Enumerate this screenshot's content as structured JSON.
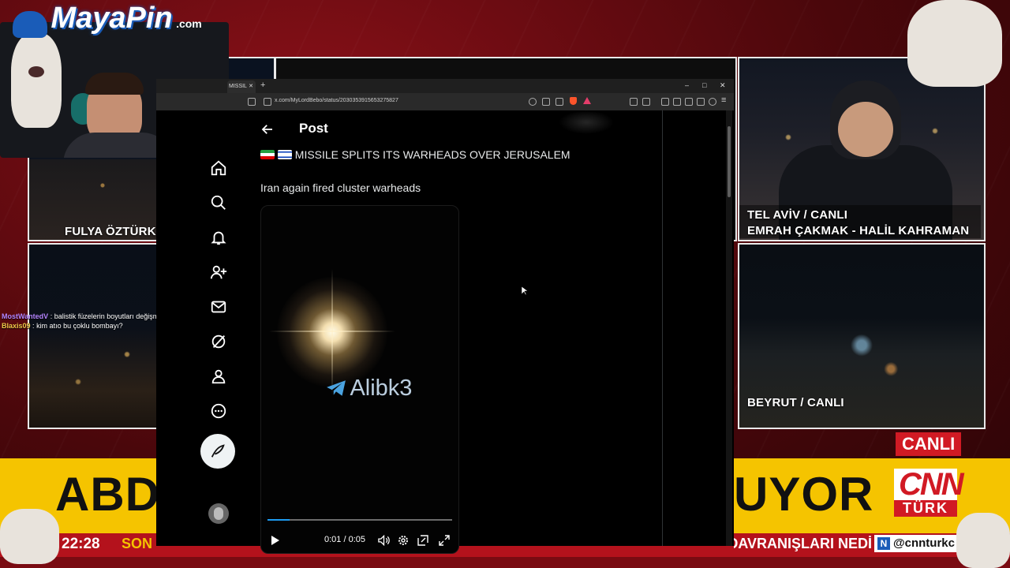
{
  "colors": {
    "cnn_red": "#d11a24",
    "ticker_yellow": "#f5c400",
    "x_blue": "#1d9bf0"
  },
  "overlay": {
    "logo": {
      "name": "MayaPin",
      "suffix": ".com"
    },
    "chat": [
      {
        "user": "MostWantedV",
        "message": "balistik füzelerin boyutları değişmiş",
        "color": "#b585ff"
      },
      {
        "user": "Blaxis09",
        "message": "kim atıo bu çoklu bombayı?",
        "color": "#f0c84a"
      }
    ]
  },
  "tv": {
    "tiles": {
      "top_left": "FULYA ÖZTÜRK",
      "top_right_line1": "TEL AVİV / CANLI",
      "top_right_line2": "EMRAH ÇAKMAK - HALİL KAHRAMAN",
      "bottom_right": "BEYRUT / CANLI"
    },
    "live_badge": "CANLI",
    "headline_left": "ABD",
    "headline_right": "UYOR",
    "clock": "22:28",
    "ticker_left": "SON",
    "ticker_text": "TRUMP: ARAYIN KUYU DAVRANIŞLARI NEDİ",
    "handle": "@cnnturkc",
    "brand": {
      "cnn": "CNN",
      "turk": "TÜRK"
    }
  },
  "browser": {
    "tab_title": "MISSIL",
    "url": "x.com/MyLordBebo/status/2030353915653275827",
    "window_controls": [
      "–",
      "□",
      "✕"
    ]
  },
  "post": {
    "header": "Post",
    "title": "MISSILE SPLITS ITS WARHEADS OVER JERUSALEM",
    "body": "Iran again fired cluster warheads",
    "video": {
      "watermark": "Alibk3",
      "time": "0:01 / 0:05",
      "progress": 0.12
    }
  },
  "nav": [
    "home-icon",
    "search-icon",
    "notifications-icon",
    "follow-icon",
    "messages-icon",
    "grok-icon",
    "profile-icon",
    "more-icon"
  ]
}
